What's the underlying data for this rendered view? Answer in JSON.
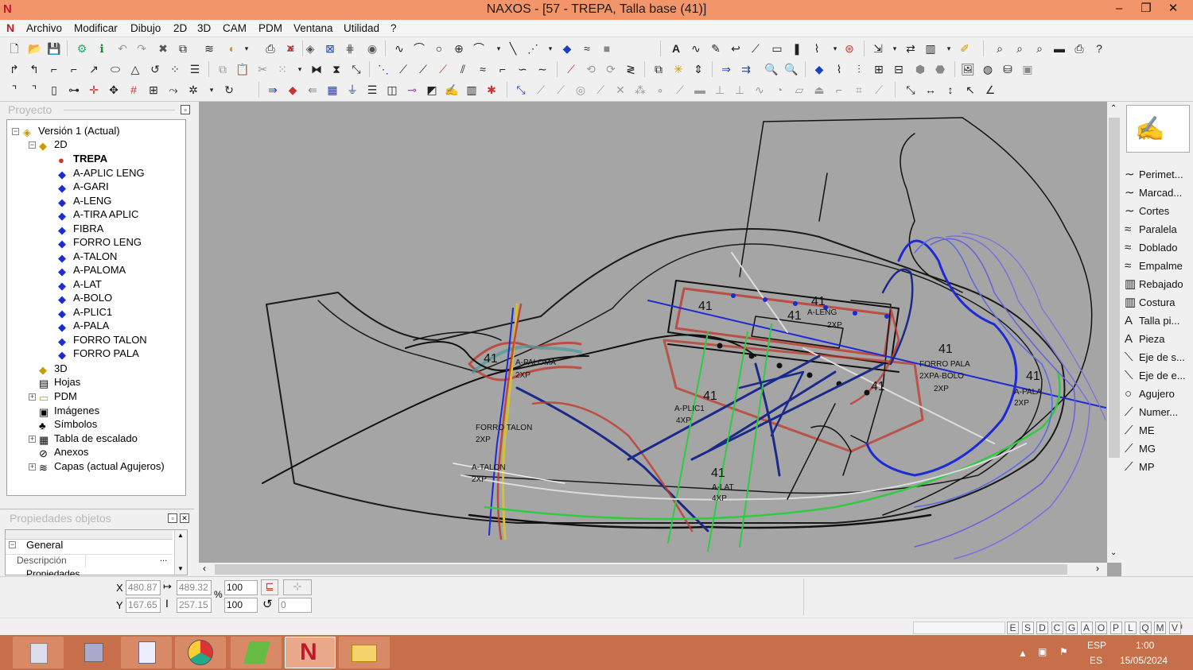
{
  "window": {
    "title": "NAXOS - [57 - TREPA, Talla base (41)]",
    "app_icon": "N"
  },
  "menu": [
    "Archivo",
    "Modificar",
    "Dibujo",
    "2D",
    "3D",
    "CAM",
    "PDM",
    "Ventana",
    "Utilidad",
    "?"
  ],
  "panels": {
    "project_title": "Proyecto",
    "props_title": "Propiedades objetos",
    "props_group": "General",
    "props_field": "Descripción",
    "props_field_btn": "...",
    "props_partial": "Propiedades"
  },
  "tree": {
    "root": "Versión 1 (Actual)",
    "folder2d": "2D",
    "pieces": [
      "TREPA",
      "A-APLIC LENG",
      "A-GARI",
      "A-LENG",
      "A-TIRA APLIC",
      "FIBRA",
      "FORRO LENG",
      "A-TALON",
      "A-PALOMA",
      "A-LAT",
      "A-BOLO",
      "A-PLIC1",
      "A-PALA",
      "FORRO TALON",
      "FORRO PALA"
    ],
    "others": [
      "3D",
      "Hojas",
      "PDM",
      "Imágenes",
      "Símbolos",
      "Tabla de escalado",
      "Anexos",
      "Capas (actual Agujeros)"
    ]
  },
  "right_tools": [
    "Perimet...",
    "Marcad...",
    "Cortes",
    "Paralela",
    "Doblado",
    "Empalme",
    "Rebajado",
    "Costura",
    "Talla pi...",
    "Pieza",
    "Eje de s...",
    "Eje de e...",
    "Agujero",
    "Numer...",
    "ME",
    "MG",
    "MP"
  ],
  "right_tool_icons": [
    "perimeter-icon",
    "marker-icon",
    "cuts-icon",
    "parallel-icon",
    "fold-icon",
    "join-icon",
    "skive-icon",
    "seam-icon",
    "size-text-icon",
    "piece-text-icon",
    "sym-axis-icon",
    "axis-icon",
    "hole-icon",
    "number-icon",
    "me-icon",
    "mg-icon",
    "mp-icon"
  ],
  "drawing_labels": [
    {
      "text": "41",
      "id": "lbl-41-a"
    },
    {
      "text": "A-LENG",
      "id": "lbl-aleng"
    },
    {
      "text": "2XP",
      "id": "lbl-2xp-a"
    },
    {
      "text": "41",
      "id": "lbl-41-b"
    },
    {
      "text": "41",
      "id": "lbl-41-c"
    },
    {
      "text": "A-PALOMA",
      "id": "lbl-apaloma"
    },
    {
      "text": "2XP",
      "id": "lbl-2xp-b"
    },
    {
      "text": "41",
      "id": "lbl-41-d"
    },
    {
      "text": "FORRO PALA",
      "id": "lbl-forropala"
    },
    {
      "text": "2XPA-BOLO",
      "id": "lbl-2xpabolo"
    },
    {
      "text": "2XP",
      "id": "lbl-2xp-c"
    },
    {
      "text": "41",
      "id": "lbl-41-e"
    },
    {
      "text": "A-PALA",
      "id": "lbl-apala"
    },
    {
      "text": "2XP",
      "id": "lbl-2xp-d"
    },
    {
      "text": "41",
      "id": "lbl-41-f"
    },
    {
      "text": "A-PLIC1",
      "id": "lbl-aplic1"
    },
    {
      "text": "4XP",
      "id": "lbl-4xp-a"
    },
    {
      "text": "FORRO TALON",
      "id": "lbl-forrotalon"
    },
    {
      "text": "2XP",
      "id": "lbl-2xp-e"
    },
    {
      "text": "A-TALON",
      "id": "lbl-atalon"
    },
    {
      "text": "2XP",
      "id": "lbl-2xp-f"
    },
    {
      "text": "41",
      "id": "lbl-41-g"
    },
    {
      "text": "A-LAT",
      "id": "lbl-alat"
    },
    {
      "text": "4XP",
      "id": "lbl-4xp-b"
    },
    {
      "text": "41",
      "id": "lbl-41-h"
    },
    {
      "text": "41",
      "id": "lbl-41-i"
    }
  ],
  "coords": {
    "x_label": "X",
    "y_label": "Y",
    "x": "480.87",
    "y": "167.65",
    "w": "489.32",
    "h": "257.15",
    "scale_x": "100",
    "scale_y": "100",
    "percent": "%",
    "rotation": "0"
  },
  "status_letters": [
    "E",
    "S",
    "D",
    "C",
    "G",
    "A",
    "O",
    "P",
    "L",
    "Q",
    "M",
    "V"
  ],
  "taskbar": {
    "lang_top": "ESP",
    "lang_bottom": "ES",
    "time": "1:00",
    "date": "15/05/2024"
  },
  "taskbar_apps": [
    "calculator-app",
    "remote-app",
    "explorer-app",
    "chrome-app",
    "cad-app",
    "naxos-app",
    "files-app"
  ],
  "colors": {
    "titlebar": "#f3956b",
    "taskbar": "#c76e4a",
    "canvas": "#a5a5a5",
    "piece_marker": "#1c2bd6",
    "active_piece": "#c0392b"
  }
}
